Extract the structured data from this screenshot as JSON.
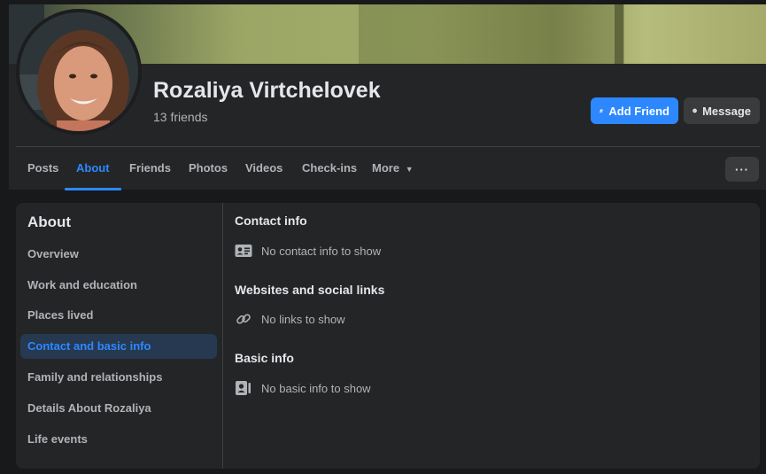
{
  "profile": {
    "name": "Rozaliya Virtchelovek",
    "friends_count": "13 friends"
  },
  "actions": {
    "add_friend": "Add Friend",
    "message": "Message",
    "more_options": "···"
  },
  "tabs": [
    {
      "label": "Posts"
    },
    {
      "label": "About",
      "active": true
    },
    {
      "label": "Friends"
    },
    {
      "label": "Photos"
    },
    {
      "label": "Videos"
    },
    {
      "label": "Check-ins"
    },
    {
      "label": "More"
    }
  ],
  "about": {
    "title": "About",
    "items": [
      {
        "label": "Overview"
      },
      {
        "label": "Work and education"
      },
      {
        "label": "Places lived"
      },
      {
        "label": "Contact and basic info",
        "active": true
      },
      {
        "label": "Family and relationships"
      },
      {
        "label": "Details About Rozaliya"
      },
      {
        "label": "Life events"
      }
    ]
  },
  "content": {
    "contact_title": "Contact info",
    "contact_empty": "No contact info to show",
    "links_title": "Websites and social links",
    "links_empty": "No links to show",
    "basic_title": "Basic info",
    "basic_empty": "No basic info to show"
  },
  "colors": {
    "accent": "#2d88ff",
    "background": "#18191a",
    "card": "#242526",
    "active_item_bg": "#263951"
  },
  "icons": [
    "user-plus-icon",
    "messenger-icon",
    "caret-down-icon",
    "contact-card-icon",
    "link-icon",
    "profile-card-icon"
  ]
}
